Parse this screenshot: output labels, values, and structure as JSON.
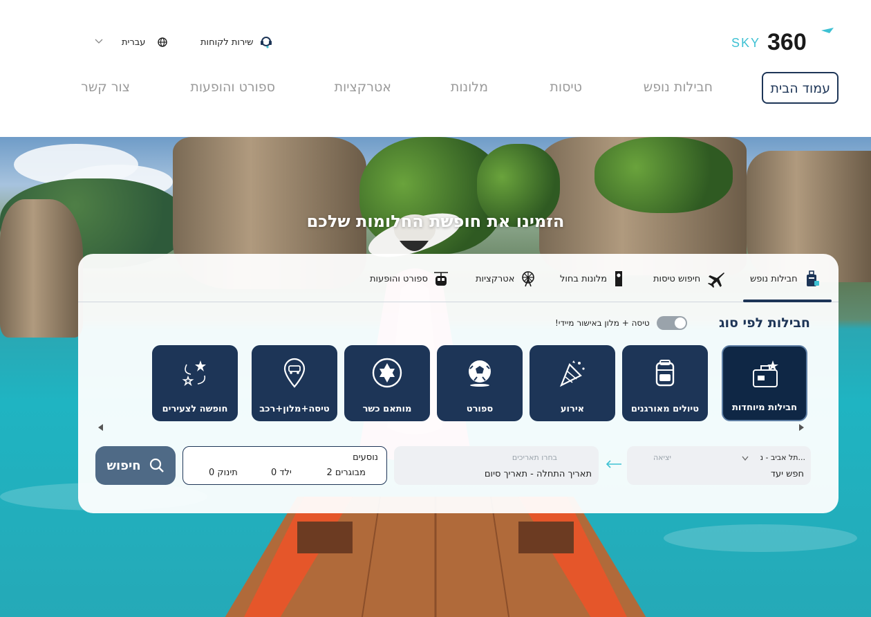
{
  "header": {
    "logo_text": "SKY360",
    "customer_service": "שירות לקוחות",
    "language": "עברית",
    "nav": [
      {
        "label": "עמוד הבית",
        "active": true
      },
      {
        "label": "חבילות נופש"
      },
      {
        "label": "טיסות"
      },
      {
        "label": "מלונות"
      },
      {
        "label": "אטרקציות"
      },
      {
        "label": "ספורט והופעות"
      },
      {
        "label": "צור קשר"
      }
    ]
  },
  "hero": {
    "title": "הזמינו את חופשת החלומות שלכם"
  },
  "search": {
    "tabs": [
      {
        "label": "חבילות נופש",
        "icon": "luggage-icon",
        "active": true
      },
      {
        "label": "חיפוש טיסות",
        "icon": "airplane-icon"
      },
      {
        "label": "מלונות בחול",
        "icon": "door-hanger-icon"
      },
      {
        "label": "אטרקציות",
        "icon": "ferris-wheel-icon"
      },
      {
        "label": "ספורט והופעות",
        "icon": "cable-car-icon"
      }
    ],
    "by_type_title": "חבילות לפי סוג",
    "toggle_label": "טיסה + מלון באישור מיידי!",
    "categories": [
      {
        "label": "חבילות מיוחדות",
        "icon": "suitcase-icon",
        "featured": true
      },
      {
        "label": "טיולים מאורגנים",
        "icon": "backpack-icon"
      },
      {
        "label": "אירוע",
        "icon": "party-popper-icon"
      },
      {
        "label": "ספורט",
        "icon": "soccer-ball-icon"
      },
      {
        "label": "מותאם כשר",
        "icon": "star-of-david-icon"
      },
      {
        "label": "טיסה+מלון+רכב",
        "icon": "map-pin-car-icon"
      },
      {
        "label": "חופשה לצעירים",
        "icon": "stars-icon"
      }
    ],
    "origin": {
      "value": "תל אביב - נ...",
      "label": "יציאה",
      "destination_placeholder": "חפש יעד"
    },
    "dates": {
      "label": "בחרו תאריכים",
      "value": "תאריך התחלה - תאריך סיום"
    },
    "passengers": {
      "title": "נוסעים",
      "adults": "2 מבוגרים",
      "children": "0 ילד",
      "infants": "0 תינוק"
    },
    "search_button": "חיפוש"
  },
  "colors": {
    "primary": "#1d3557",
    "accent": "#4f6a86",
    "logo_teal": "#3ec1d3"
  }
}
